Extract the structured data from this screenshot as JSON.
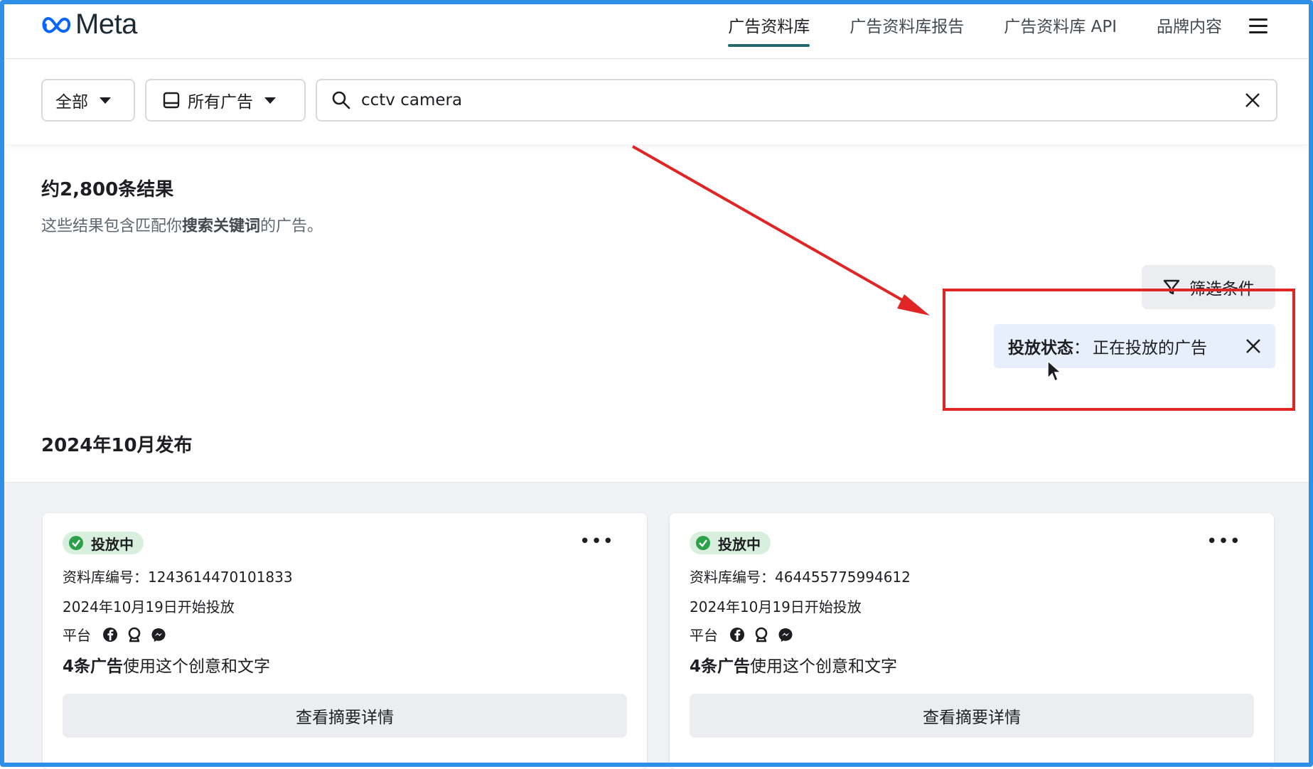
{
  "header": {
    "brand": "Meta",
    "nav": [
      {
        "label": "广告资料库",
        "active": true
      },
      {
        "label": "广告资料库报告",
        "active": false
      },
      {
        "label": "广告资料库 API",
        "active": false
      },
      {
        "label": "品牌内容",
        "active": false
      }
    ],
    "menu_icon": "hamburger-menu-icon"
  },
  "search": {
    "country_filter": "全部",
    "ad_type_filter": "所有广告",
    "query": "cctv camera",
    "clear_icon": "close-icon"
  },
  "results": {
    "count_text": "约2,800条结果",
    "subtitle_prefix": "这些结果包含匹配你",
    "subtitle_bold": "搜索关键词",
    "subtitle_suffix": "的广告。",
    "filter_button": "筛选条件",
    "active_filter": {
      "key": "投放状态",
      "separator": "：",
      "value": "正在投放的广告"
    },
    "section_title": "2024年10月发布"
  },
  "cards": [
    {
      "status": "投放中",
      "library_id_label": "资料库编号：",
      "library_id": "1243614470101833",
      "start_date": "2024年10月19日开始投放",
      "platform_label": "平台",
      "platforms": [
        "facebook-icon",
        "audience-network-icon",
        "messenger-icon"
      ],
      "usage_bold": "4条广告",
      "usage_rest": "使用这个创意和文字",
      "detail_button": "查看摘要详情"
    },
    {
      "status": "投放中",
      "library_id_label": "资料库编号：",
      "library_id": "464455775994612",
      "start_date": "2024年10月19日开始投放",
      "platform_label": "平台",
      "platforms": [
        "facebook-icon",
        "audience-network-icon",
        "messenger-icon"
      ],
      "usage_bold": "4条广告",
      "usage_rest": "使用这个创意和文字",
      "detail_button": "查看摘要详情"
    }
  ],
  "colors": {
    "frame": "#2e8fe6",
    "annotation": "#e02525",
    "chip_bg": "#e7eefc",
    "active_tab_underline": "#25696e",
    "status_badge_bg": "#d8efdd",
    "status_check": "#2ba14a"
  }
}
